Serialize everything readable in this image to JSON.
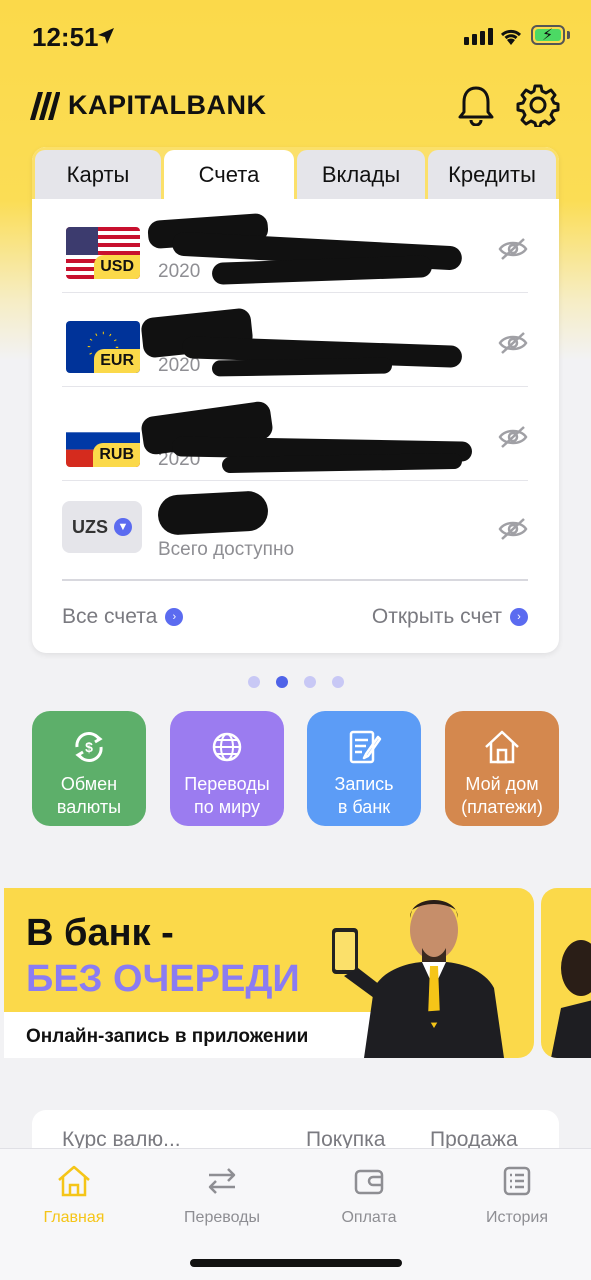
{
  "status_bar": {
    "time": "12:51"
  },
  "header": {
    "logo_text": "KAPITALBANK",
    "notification_icon": "bell-icon",
    "settings_icon": "gear-icon"
  },
  "tabs": [
    {
      "label": "Карты",
      "active": false
    },
    {
      "label": "Счета",
      "active": true
    },
    {
      "label": "Вклады",
      "active": false
    },
    {
      "label": "Кредиты",
      "active": false
    }
  ],
  "accounts": [
    {
      "currency": "USD",
      "subtitle": "2020",
      "masked": true
    },
    {
      "currency": "EUR",
      "subtitle": "2020",
      "masked": true
    },
    {
      "currency": "RUB",
      "subtitle": "2020",
      "masked": true
    }
  ],
  "total": {
    "currency": "UZS",
    "subtitle": "Всего доступно"
  },
  "card_footer": {
    "all_accounts": "Все счета",
    "open_account": "Открыть счет"
  },
  "pager": {
    "count": 4,
    "active_index": 1
  },
  "quick_actions": [
    {
      "label_line1": "Обмен",
      "label_line2": "валюты",
      "icon": "currency-exchange-icon",
      "color": "#5DAF6A"
    },
    {
      "label_line1": "Переводы",
      "label_line2": "по миру",
      "icon": "globe-icon",
      "color": "#9B7CF0"
    },
    {
      "label_line1": "Запись",
      "label_line2": "в банк",
      "icon": "document-edit-icon",
      "color": "#5C9CF6"
    },
    {
      "label_line1": "Мой дом",
      "label_line2": "(платежи)",
      "icon": "house-icon",
      "color": "#D4884E"
    }
  ],
  "banner": {
    "title_line1": "В банк -",
    "title_line2": "БЕЗ ОЧЕРЕДИ",
    "subtitle": "Онлайн-запись в приложении"
  },
  "rates": {
    "title": "Курс валю...",
    "buy": "Покупка",
    "sell": "Продажа"
  },
  "tabbar": [
    {
      "label": "Главная",
      "icon": "home-icon",
      "active": true
    },
    {
      "label": "Переводы",
      "icon": "transfer-arrows-icon",
      "active": false
    },
    {
      "label": "Оплата",
      "icon": "wallet-icon",
      "active": false
    },
    {
      "label": "История",
      "icon": "history-list-icon",
      "active": false
    }
  ],
  "colors": {
    "brand_yellow": "#FBD94A",
    "accent_blue": "#4F63E8",
    "active_tab": "#F5C518"
  }
}
